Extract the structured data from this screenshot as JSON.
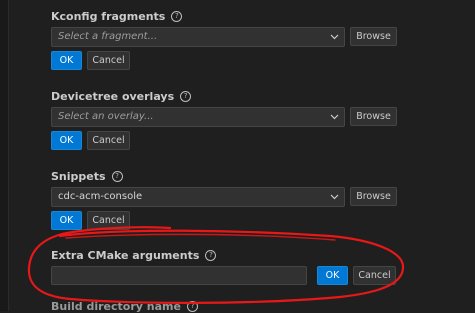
{
  "sections": {
    "kconfig": {
      "label": "Kconfig fragments",
      "placeholder": "Select a fragment...",
      "browse": "Browse",
      "ok": "OK",
      "cancel": "Cancel"
    },
    "devicetree": {
      "label": "Devicetree overlays",
      "placeholder": "Select an overlay...",
      "browse": "Browse",
      "ok": "OK",
      "cancel": "Cancel"
    },
    "snippets": {
      "label": "Snippets",
      "value": "cdc-acm-console",
      "browse": "Browse",
      "ok": "OK",
      "cancel": "Cancel"
    },
    "extra_cmake": {
      "label": "Extra CMake arguments",
      "value": "",
      "ok": "OK",
      "cancel": "Cancel"
    },
    "build_dir": {
      "label": "Build directory name"
    }
  },
  "icons": {
    "help": "help-circle-icon",
    "chevron": "chevron-down-icon"
  },
  "help_glyph": "?",
  "colors": {
    "background": "#1f1f1f",
    "input_bg": "#313131",
    "primary_button": "#0078d4",
    "annotation": "#e81818"
  }
}
